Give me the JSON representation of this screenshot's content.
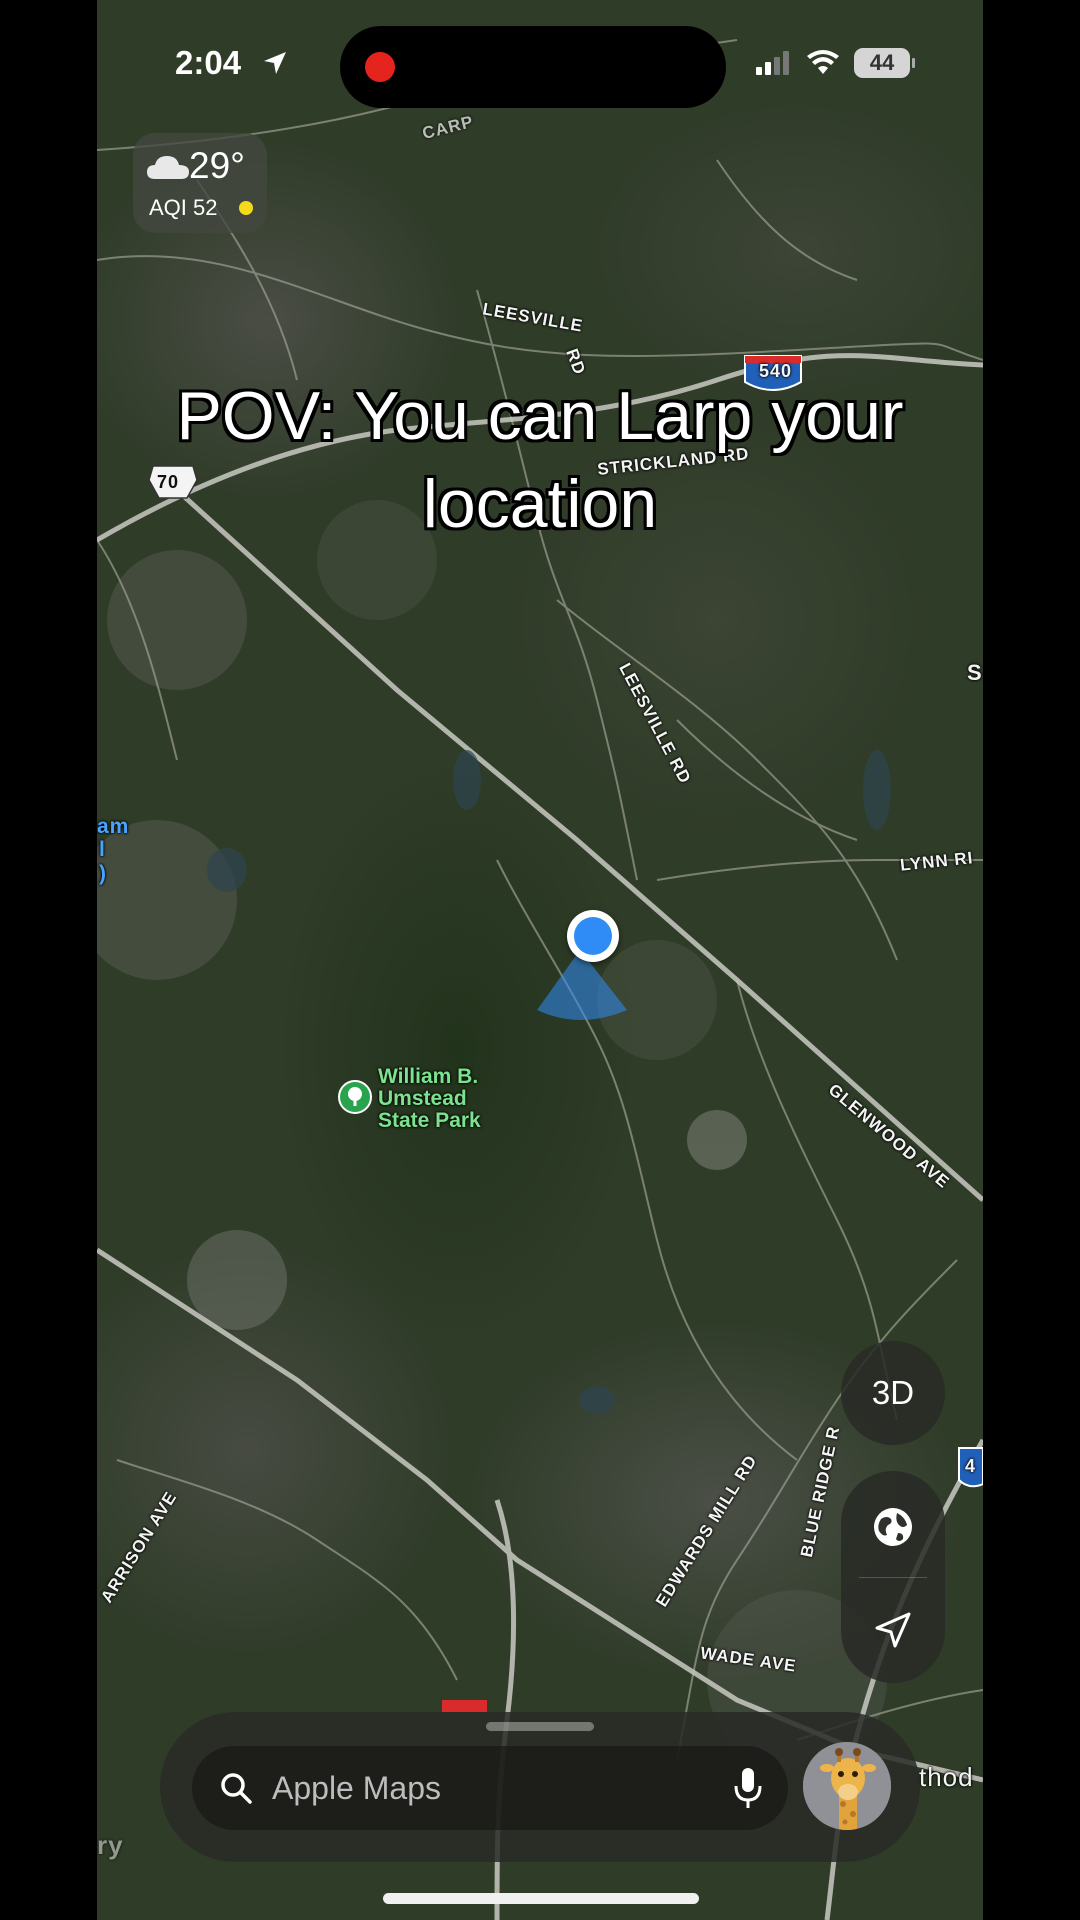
{
  "status_bar": {
    "time": "2:04",
    "battery": "44"
  },
  "weather": {
    "temperature": "29°",
    "aqi": "AQI 52",
    "icon": "cloud-icon"
  },
  "caption": "POV: You can Larp your location",
  "map": {
    "type": "satellite",
    "road_labels": {
      "leesville_top": "LEESVILLE",
      "leesville_rd_top": "RD",
      "strickland": "STRICKLAND RD",
      "leesville_rd": "LEESVILLE RD",
      "lynn": "LYNN RI",
      "glenwood": "GLENWOOD AVE",
      "edwards_mill": "EDWARDS MILL RD",
      "blue_ridge": "BLUE RIDGE R",
      "wade": "WADE AVE",
      "harrison": "ARRISON AVE",
      "carp": "CARP",
      "shield_540": "540",
      "shield_70": "70",
      "shield_4": "4",
      "edge_s": "S",
      "edge_thod": "thod",
      "edge_am": "am",
      "edge_l": "l",
      "edge_paren": ")",
      "edge_ry": "ry"
    },
    "poi": {
      "name_line1": "William B.",
      "name_line2": "Umstead",
      "name_line3": "State Park",
      "icon": "park-tree-icon"
    }
  },
  "controls": {
    "view_3d": "3D",
    "globe_icon": "globe-icon",
    "locate_icon": "location-arrow-icon"
  },
  "search": {
    "placeholder": "Apple Maps",
    "icon": "search-icon",
    "mic_icon": "microphone-icon",
    "avatar": "giraffe-avatar"
  },
  "colors": {
    "accent_blue": "#2f8cf6",
    "park_green": "#2aa34f",
    "record_red": "#e5241e",
    "aqi_yellow": "#f5d91b"
  }
}
